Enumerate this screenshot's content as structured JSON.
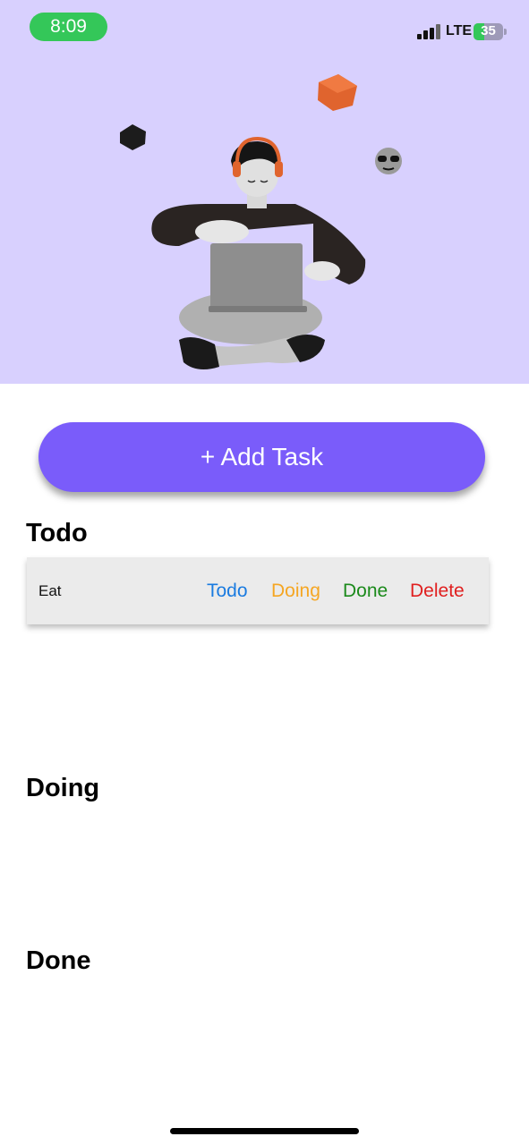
{
  "status_bar": {
    "time": "8:09",
    "network": "LTE",
    "battery_level": "35",
    "battery_fraction": 0.35
  },
  "hero": {
    "illustration": "person-with-laptop-3d-illustration",
    "background_color": "#d8d0fe"
  },
  "add_task": {
    "label": "+ Add Task",
    "color": "#7a5cfa"
  },
  "sections": {
    "todo": "Todo",
    "doing": "Doing",
    "done": "Done"
  },
  "todo_tasks": [
    {
      "name": "Eat",
      "actions": {
        "todo": "Todo",
        "doing": "Doing",
        "done": "Done",
        "delete": "Delete"
      }
    }
  ],
  "action_colors": {
    "todo": "#1a7be0",
    "doing": "#f5a623",
    "done": "#1b8a1b",
    "delete": "#e02020"
  }
}
